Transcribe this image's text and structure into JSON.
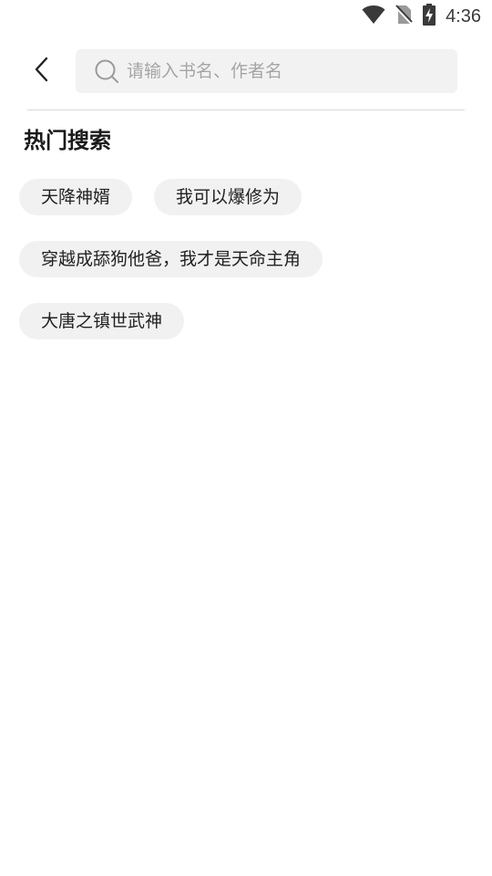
{
  "status_bar": {
    "time": "4:36",
    "icons": [
      "wifi-icon",
      "no-sim-icon",
      "battery-charging-icon"
    ]
  },
  "header": {
    "back_icon": "back-arrow-icon",
    "search": {
      "icon": "search-icon",
      "placeholder": "请输入书名、作者名",
      "value": ""
    }
  },
  "hot_search": {
    "title": "热门搜索",
    "tags": [
      "天降神婿",
      "我可以爆修为",
      "穿越成舔狗他爸，我才是天命主角",
      "大唐之镇世武神"
    ]
  },
  "colors": {
    "background": "#ffffff",
    "search_bg": "#f2f2f2",
    "tag_bg": "#f1f1f1",
    "placeholder": "#a5a5a5",
    "text": "#222222"
  }
}
